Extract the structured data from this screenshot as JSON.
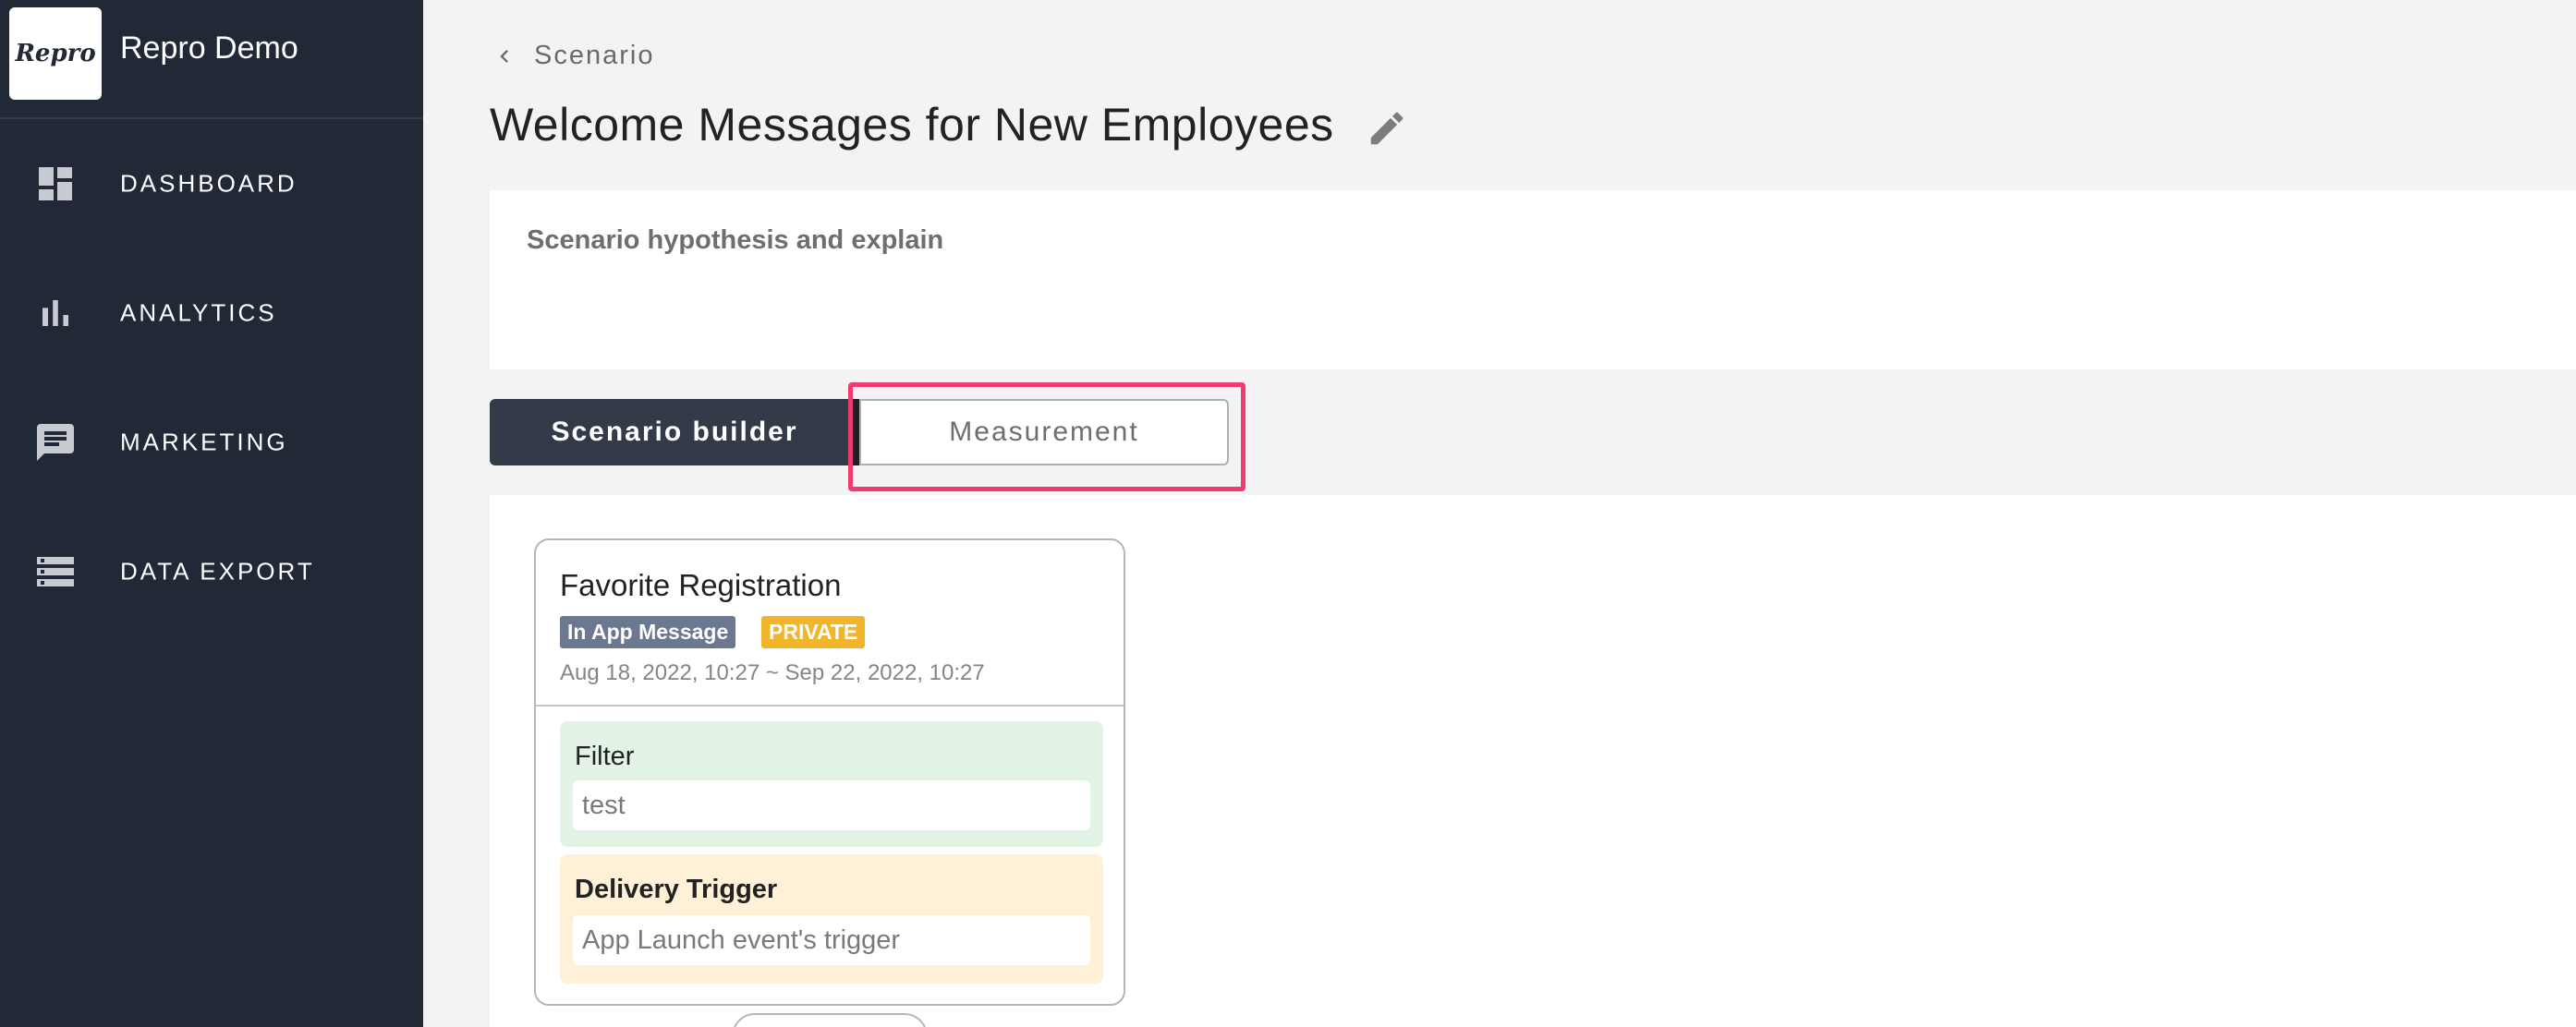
{
  "sidebar": {
    "brand": {
      "logo_text": "Repro",
      "name": "Repro Demo"
    },
    "items": [
      {
        "label": "DASHBOARD",
        "icon": "dashboard-icon"
      },
      {
        "label": "ANALYTICS",
        "icon": "bar-chart-icon"
      },
      {
        "label": "MARKETING",
        "icon": "message-icon"
      },
      {
        "label": "DATA EXPORT",
        "icon": "list-icon"
      }
    ]
  },
  "header": {
    "breadcrumb": "Scenario",
    "title": "Welcome Messages for New Employees"
  },
  "hypothesis": {
    "label": "Scenario hypothesis and explain"
  },
  "tabs": {
    "builder": "Scenario builder",
    "measurement": "Measurement"
  },
  "card": {
    "title": "Favorite Registration",
    "badge_type": "In App Message",
    "badge_private": "PRIVATE",
    "dates": "Aug 18, 2022, 10:27 ~ Sep 22, 2022, 10:27",
    "filter": {
      "label": "Filter",
      "value": "test"
    },
    "delivery": {
      "label": "Delivery Trigger",
      "value": "App Launch event's trigger"
    }
  },
  "colors": {
    "sidebar_bg": "#212836",
    "active_tab_bg": "#333a48",
    "highlight": "#ef3b6f",
    "badge_type": "#6c7892",
    "badge_private": "#f1b52b",
    "filter_bg": "#e3f4e6",
    "delivery_bg": "#fff0d8"
  }
}
